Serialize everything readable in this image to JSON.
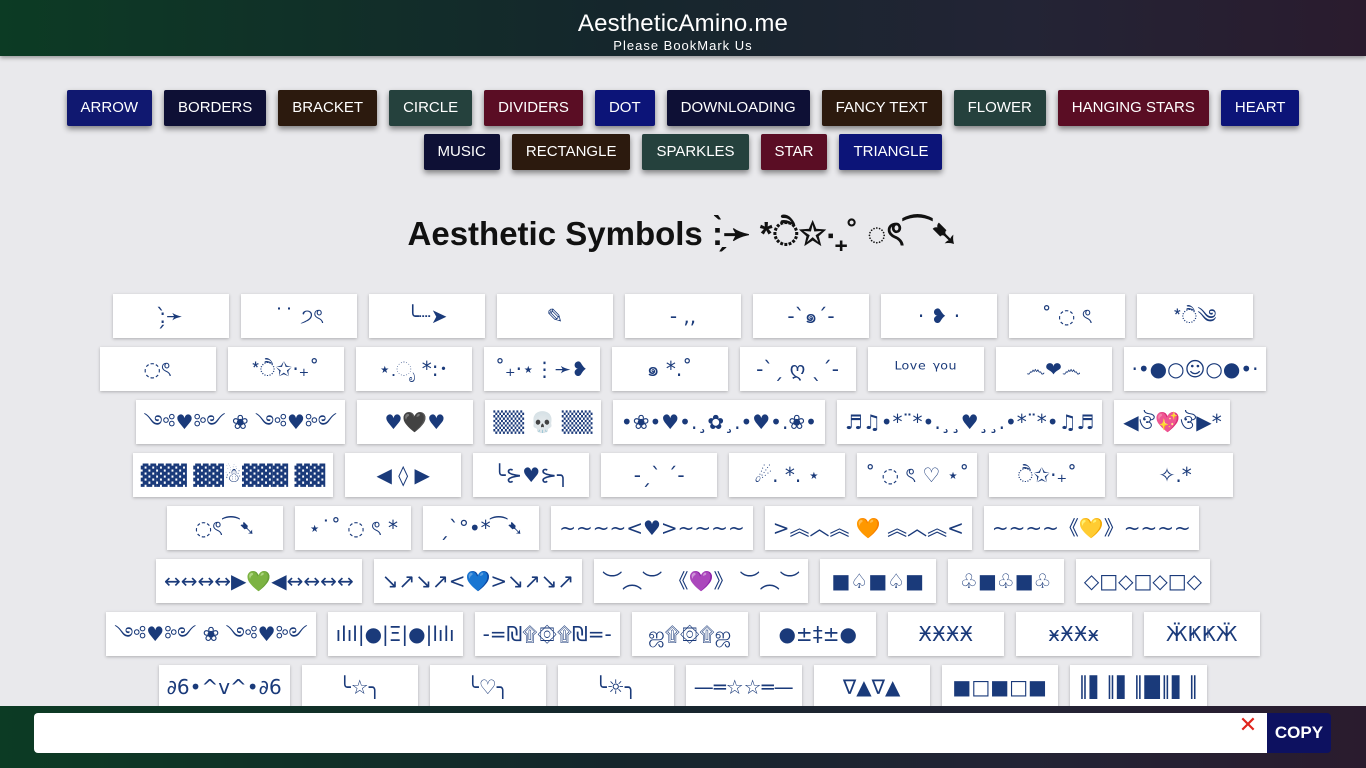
{
  "header": {
    "title": "AestheticAmino.me",
    "subtitle": "Please BookMark Us"
  },
  "categories": [
    {
      "label": "ARROW",
      "color": "#101870"
    },
    {
      "label": "BORDERS",
      "color": "#0e1035"
    },
    {
      "label": "BRACKET",
      "color": "#2c1a0e"
    },
    {
      "label": "CIRCLE",
      "color": "#25413d"
    },
    {
      "label": "DIVIDERS",
      "color": "#5a0d24"
    },
    {
      "label": "DOT",
      "color": "#0c1478"
    },
    {
      "label": "DOWNLOADING",
      "color": "#0e1035"
    },
    {
      "label": "FANCY TEXT",
      "color": "#2c1a0e"
    },
    {
      "label": "FLOWER",
      "color": "#25413d"
    },
    {
      "label": "HANGING STARS",
      "color": "#5a0d24"
    },
    {
      "label": "HEART",
      "color": "#0c1478"
    },
    {
      "label": "MUSIC",
      "color": "#0e1035"
    },
    {
      "label": "RECTANGLE",
      "color": "#2c1a0e"
    },
    {
      "label": "SPARKLES",
      "color": "#25413d"
    },
    {
      "label": "STAR",
      "color": "#5a0d24"
    },
    {
      "label": "TRIANGLE",
      "color": "#0c1478"
    }
  ],
  "heading": "Aesthetic Symbols :̗̀➛ *ੈ✩‧₊˚ ◌ৎ⁀➷",
  "symbols": [
    ":̗̀➛",
    "˙˙ ੭ৎ",
    "╰┈➤",
    "✎",
    "- ,,",
    "-ˋ๑ˊ-",
    "· ❥ ·",
    "˚ ◌ ৎ",
    "*ੈ༄",
    "◌ৎ",
    "*ੈ✩‧₊˚",
    "⋆.ೃ *:･",
    "˚₊‧⋆⋮➛❥",
    "๑ *.˚",
    "-ˋˏ ღ ˎˊ-",
    "ᴸᵒᵛᵉ ᵞᵒᵘ",
    "෴❤෴",
    "·•●○☺○●•·",
    "༺♥༻ ❀ ༺♥༻",
    "♥🖤♥",
    "▒▒ 💀 ▒▒",
    "•❀•♥•.¸✿¸.•♥•.❀•",
    "♬♫•*¨*•.¸¸♥¸¸.•*¨*•♫♬",
    "◀ঔ💖ঔ▶*",
    "▓▓▓ ▓▓☃▓▓▓ ▓▓",
    "◀ ◊ ▶",
    "╰⊱♥⊱╮",
    "-ˏˋ ˊ-",
    "☄. *. ⋆",
    "˚ ◌ ৎ ♡ ⋆˚",
    "ੈ✩‧₊˚",
    "✧.*",
    "◌ৎ⁀➷",
    "⋆˙˚ ◌ ৎ *",
    "ˏˋ°•*⁀➷",
    "~~~~<♥>~~~~",
    ">︽︿︽ 🧡 ︽︿︽<",
    "~~~~《💛》~~~~",
    "↔↔↔↔▶💚◀↔↔↔↔",
    "↘↗↘↗<💙>↘↗↘↗",
    "︶︵︶ 《💜》 ︶︵︶",
    "■♤■♤■",
    "♧■♧■♧",
    "◇□◇□◇□◇",
    "༺♥༻ ❀ ༺♥༻",
    "ılıl|●|Ξ|●|lılı",
    "-=₪۩۞۩₪=-",
    "ஜ۩۞۩ஜ",
    "●±‡±●",
    "ӾӾӾӾ",
    "ӿӾӾӿ",
    "ӜҜҜӜ",
    "∂6•^v^•∂6",
    "╰☆╮",
    "╰♡╮",
    "╰☼╮",
    "—═☆☆═—",
    "∇▲∇▲",
    "■□■□■",
    "║▌║▌║█║▌║"
  ],
  "copy_bar": {
    "value": "",
    "placeholder": "",
    "clear_glyph": "✕",
    "copy_label": "COPY"
  }
}
